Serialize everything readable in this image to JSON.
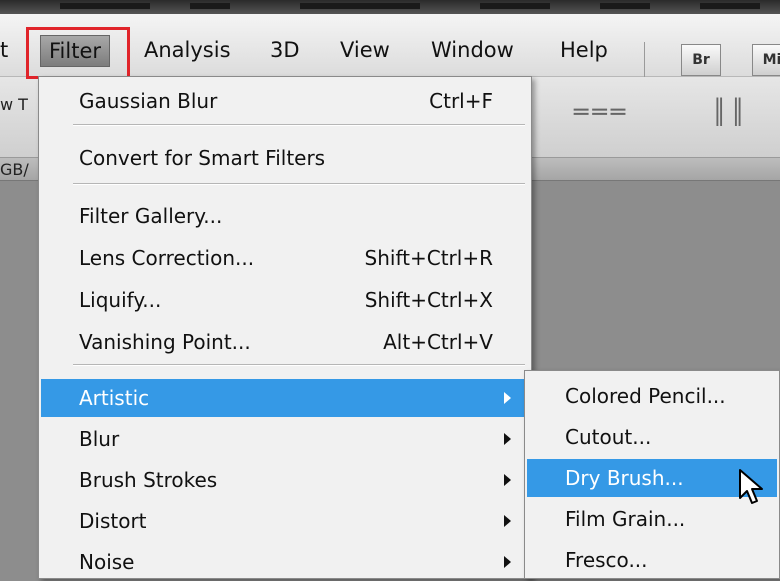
{
  "menubar": {
    "items": [
      {
        "label": "t"
      },
      {
        "label": "Filter"
      },
      {
        "label": "Analysis"
      },
      {
        "label": "3D"
      },
      {
        "label": "View"
      },
      {
        "label": "Window"
      },
      {
        "label": "Help"
      }
    ],
    "bridge_button": "Br",
    "mini_bridge_button": "Mi"
  },
  "left_edge": {
    "options_text": "w T",
    "doc_tab_text": "GB/"
  },
  "filter_menu": {
    "last_filter": {
      "label": "Gaussian Blur",
      "shortcut": "Ctrl+F"
    },
    "convert": {
      "label": "Convert for Smart Filters"
    },
    "filter_gallery": {
      "label": "Filter Gallery..."
    },
    "lens_correction": {
      "label": "Lens Correction...",
      "shortcut": "Shift+Ctrl+R"
    },
    "liquify": {
      "label": "Liquify...",
      "shortcut": "Shift+Ctrl+X"
    },
    "vanishing_point": {
      "label": "Vanishing Point...",
      "shortcut": "Alt+Ctrl+V"
    },
    "submenus": [
      {
        "label": "Artistic"
      },
      {
        "label": "Blur"
      },
      {
        "label": "Brush Strokes"
      },
      {
        "label": "Distort"
      },
      {
        "label": "Noise"
      }
    ]
  },
  "artistic_submenu": {
    "items": [
      {
        "label": "Colored Pencil..."
      },
      {
        "label": "Cutout..."
      },
      {
        "label": "Dry Brush..."
      },
      {
        "label": "Film Grain..."
      },
      {
        "label": "Fresco..."
      }
    ]
  },
  "colors": {
    "selection": "#3599e6",
    "highlight_box": "#e0242a"
  }
}
